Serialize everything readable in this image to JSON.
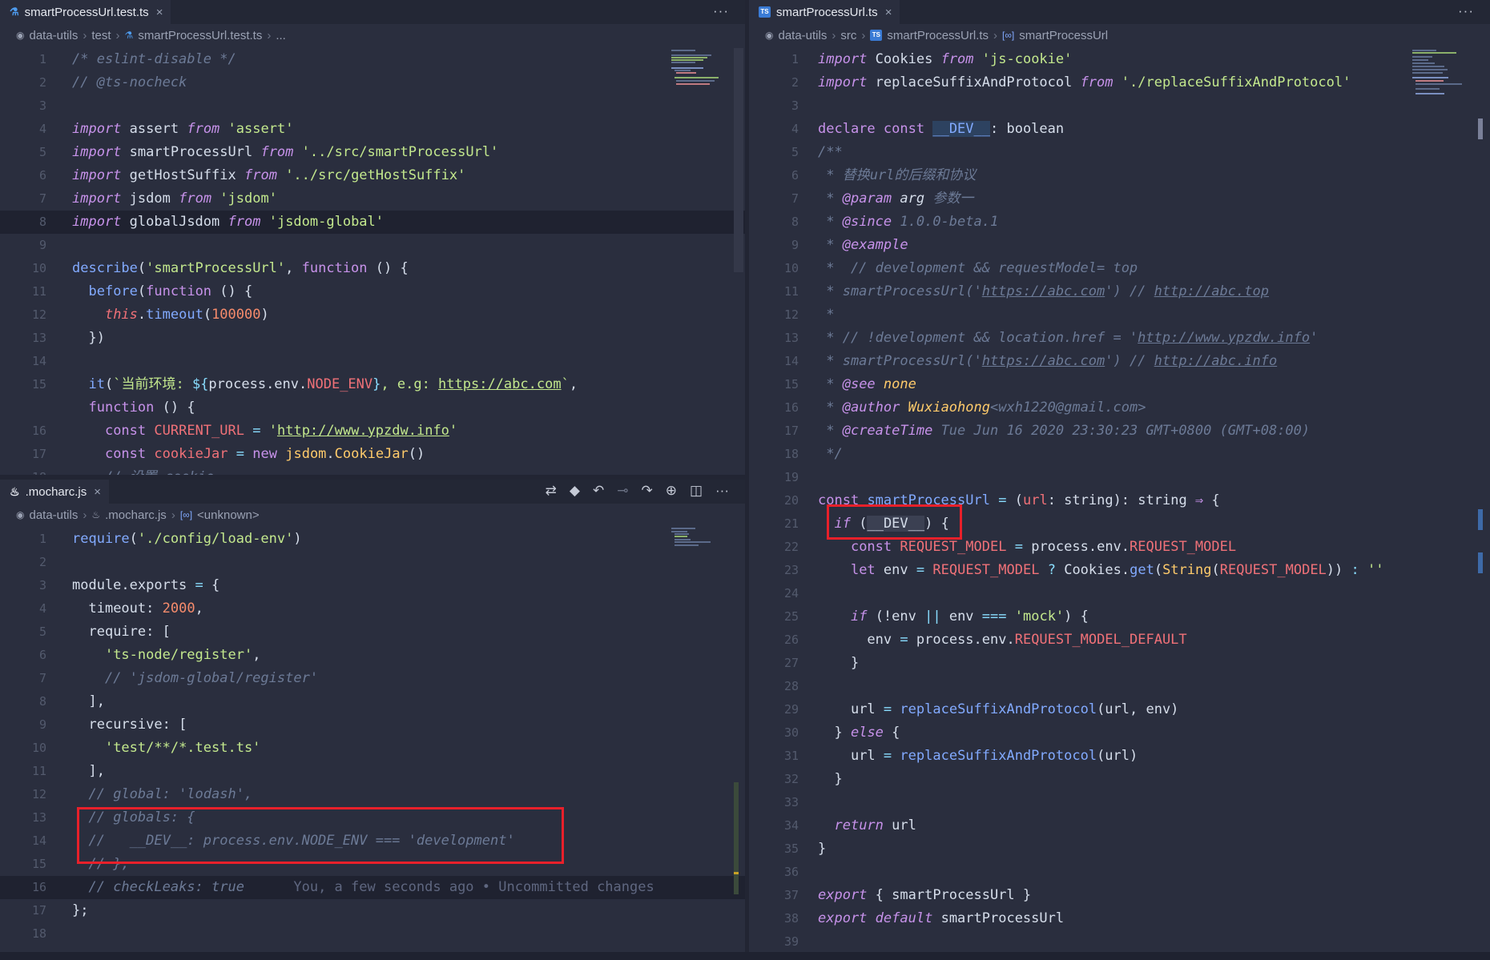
{
  "top_left": {
    "tab": {
      "label": "smartProcessUrl.test.ts",
      "close": "×"
    },
    "more": "···",
    "breadcrumb": [
      "data-utils",
      "test",
      "smartProcessUrl.test.ts",
      "..."
    ],
    "lines": [
      {
        "n": "1",
        "html": "<span class='cm'>/* eslint-disable */</span>"
      },
      {
        "n": "2",
        "html": "<span class='cm'>// @ts-nocheck</span>"
      },
      {
        "n": "3",
        "html": ""
      },
      {
        "n": "4",
        "html": "<span class='kw'>import</span> <span class='plain'>assert</span> <span class='kw'>from</span> <span class='str'>'assert'</span>"
      },
      {
        "n": "5",
        "html": "<span class='kw'>import</span> <span class='plain'>smartProcessUrl</span> <span class='kw'>from</span> <span class='str'>'../src/smartProcessUrl'</span>"
      },
      {
        "n": "6",
        "html": "<span class='kw'>import</span> <span class='plain'>getHostSuffix</span> <span class='kw'>from</span> <span class='str'>'../src/getHostSuffix'</span>"
      },
      {
        "n": "7",
        "html": "<span class='kw'>import</span> <span class='plain'>jsdom</span> <span class='kw'>from</span> <span class='str'>'jsdom'</span>"
      },
      {
        "n": "8",
        "html": "<span class='kw'>import</span> <span class='plain'>globalJsdom</span> <span class='kw'>from</span> <span class='str'>'jsdom-global'</span>",
        "hl": true
      },
      {
        "n": "9",
        "html": ""
      },
      {
        "n": "10",
        "html": "<span class='fn'>describe</span><span class='plain'>(</span><span class='str'>'smartProcessUrl'</span><span class='plain'>, </span><span class='kw2'>function</span><span class='plain'> () {</span>"
      },
      {
        "n": "11",
        "html": "  <span class='fn'>before</span><span class='plain'>(</span><span class='kw2'>function</span><span class='plain'> () {</span>"
      },
      {
        "n": "12",
        "html": "    <span class='var' style='font-style:italic'>this</span><span class='plain'>.</span><span class='fn'>timeout</span><span class='plain'>(</span><span class='num'>100000</span><span class='plain'>)</span>"
      },
      {
        "n": "13",
        "html": "  <span class='plain'>})</span>"
      },
      {
        "n": "14",
        "html": ""
      },
      {
        "n": "15",
        "html": "  <span class='fn'>it</span><span class='plain'>(</span><span class='str'>`当前环境: </span><span class='op'>${</span><span class='plain'>process.env.</span><span class='var'>NODE_ENV</span><span class='op'>}</span><span class='str'>, e.g: <u>https://abc.com</u>`</span><span class='plain'>,</span>"
      },
      {
        "n": "",
        "html": "  <span class='kw2'>function</span><span class='plain'> () {</span>"
      },
      {
        "n": "16",
        "html": "    <span class='kw2'>const</span> <span class='var'>CURRENT_URL</span> <span class='op'>=</span> <span class='str'>'<u>http://www.ypzdw.info</u>'</span>"
      },
      {
        "n": "17",
        "html": "    <span class='kw2'>const</span> <span class='var'>cookieJar</span> <span class='op'>=</span> <span class='kw2'>new</span> <span class='tp'>jsdom</span><span class='plain'>.</span><span class='tp'>CookieJar</span><span class='plain'>()</span>"
      },
      {
        "n": "18",
        "html": "    <span class='cm'>// 设置 cookie</span>"
      }
    ]
  },
  "bottom_left": {
    "tab": {
      "label": ".mocharc.js",
      "close": "×"
    },
    "toolbar_icons": [
      "compare-icon",
      "git-icon",
      "prev-change-icon",
      "dot-icon",
      "next-change-icon",
      "history-icon",
      "split-icon",
      "more-icon"
    ],
    "toolbar_glyphs": [
      "⇄",
      "◆",
      "↶",
      "⊸",
      "↷",
      "⊕",
      "◫",
      "···"
    ],
    "breadcrumb": [
      "data-utils",
      ".mocharc.js",
      "<unknown>"
    ],
    "lines": [
      {
        "n": "1",
        "html": "<span class='fn'>require</span><span class='plain'>(</span><span class='str'>'./config/load-env'</span><span class='plain'>)</span>"
      },
      {
        "n": "2",
        "html": ""
      },
      {
        "n": "3",
        "html": "<span class='plain'>module.exports</span> <span class='op'>=</span> <span class='plain'>{</span>"
      },
      {
        "n": "4",
        "html": "  <span class='plain'>timeout: </span><span class='num'>2000</span><span class='plain'>,</span>"
      },
      {
        "n": "5",
        "html": "  <span class='plain'>require: [</span>"
      },
      {
        "n": "6",
        "html": "    <span class='str'>'ts-node/register'</span><span class='plain'>,</span>"
      },
      {
        "n": "7",
        "html": "    <span class='cm'>// 'jsdom-global/register'</span>"
      },
      {
        "n": "8",
        "html": "  <span class='plain'>],</span>"
      },
      {
        "n": "9",
        "html": "  <span class='plain'>recursive: [</span>"
      },
      {
        "n": "10",
        "html": "    <span class='str'>'test/**/*.test.ts'</span>"
      },
      {
        "n": "11",
        "html": "  <span class='plain'>],</span>"
      },
      {
        "n": "12",
        "html": "  <span class='cm'>// global: 'lodash',</span>"
      },
      {
        "n": "13",
        "html": "  <span class='cm'>// globals: {</span>"
      },
      {
        "n": "14",
        "html": "  <span class='cm'>//   __DEV__: process.env.NODE_ENV === 'development'</span>"
      },
      {
        "n": "15",
        "html": "  <span class='cm'>// },</span>"
      },
      {
        "n": "16",
        "html": "  <span class='cm'>// checkLeaks: true</span>      <span class='blame'>You, a few seconds ago • Uncommitted changes</span>",
        "hl": true
      },
      {
        "n": "17",
        "html": "<span class='plain'>};</span>"
      },
      {
        "n": "18",
        "html": ""
      }
    ]
  },
  "right": {
    "tab": {
      "label": "smartProcessUrl.ts",
      "close": "×"
    },
    "more": "···",
    "breadcrumb": [
      "data-utils",
      "src",
      "smartProcessUrl.ts",
      "smartProcessUrl"
    ],
    "lines": [
      {
        "n": "1",
        "html": "<span class='kw'>import</span> <span class='plain'>Cookies</span> <span class='kw'>from</span> <span class='str'>'js-cookie'</span>"
      },
      {
        "n": "2",
        "html": "<span class='kw'>import</span> <span class='plain'>replaceSuffixAndProtocol</span> <span class='kw'>from</span> <span class='str'>'./replaceSuffixAndProtocol'</span>"
      },
      {
        "n": "3",
        "html": ""
      },
      {
        "n": "4",
        "html": "<span class='kw2'>declare</span> <span class='kw2'>const</span> <span class='fn' style='background:#2d4260'>__DEV__</span><span class='plain'>: boolean</span>"
      },
      {
        "n": "5",
        "html": "<span class='cm'>/**</span>"
      },
      {
        "n": "6",
        "html": "<span class='cm'> * 替换url的后缀和协议</span>"
      },
      {
        "n": "7",
        "html": "<span class='cm'> * </span><span class='kw'>@param</span> <span class='plain' style='font-style:italic'>arg</span> <span class='cm'>参数一</span>"
      },
      {
        "n": "8",
        "html": "<span class='cm'> * </span><span class='kw'>@since</span> <span class='cm'>1.0.0-beta.1</span>"
      },
      {
        "n": "9",
        "html": "<span class='cm'> * </span><span class='kw'>@example</span>"
      },
      {
        "n": "10",
        "html": "<span class='cm'> *  // development &amp;&amp; requestModel= top</span>"
      },
      {
        "n": "11",
        "html": "<span class='cm'> * smartProcessUrl('<u>https://abc.com</u>') // <u>http://abc.top</u></span>"
      },
      {
        "n": "12",
        "html": "<span class='cm'> *</span>"
      },
      {
        "n": "13",
        "html": "<span class='cm'> * // !development &amp;&amp; location.href = '<u>http://www.ypzdw.info</u>'</span>"
      },
      {
        "n": "14",
        "html": "<span class='cm'> * smartProcessUrl('<u>https://abc.com</u>') // <u>http://abc.info</u></span>"
      },
      {
        "n": "15",
        "html": "<span class='cm'> * </span><span class='kw'>@see</span> <span class='tp' style='font-style:italic'>none</span>"
      },
      {
        "n": "16",
        "html": "<span class='cm'> * </span><span class='kw'>@author</span> <span class='tp' style='font-style:italic'>Wuxiaohong</span><span class='cm'>&lt;wxh1220@gmail.com&gt;</span>"
      },
      {
        "n": "17",
        "html": "<span class='cm'> * </span><span class='kw'>@createTime</span> <span class='cm'>Tue Jun 16 2020 23:30:23 GMT+0800 (GMT+08:00)</span>"
      },
      {
        "n": "18",
        "html": "<span class='cm'> */</span>"
      },
      {
        "n": "19",
        "html": ""
      },
      {
        "n": "20",
        "html": "<span class='kw2'>const</span> <span class='fn'>smartProcessUrl</span> <span class='op'>=</span> <span class='plain'>(</span><span class='var'>url</span><span class='plain'>: string): string </span><span class='kw2'>⇒</span><span class='plain'> {</span>"
      },
      {
        "n": "21",
        "html": "  <span class='kw'>if</span> <span class='plain'>(</span><span class='plain' style='background:#3b4052'>__DEV__</span><span class='plain'>) {</span>"
      },
      {
        "n": "22",
        "html": "    <span class='kw2'>const</span> <span class='var'>REQUEST_MODEL</span> <span class='op'>=</span> <span class='plain'>process.env.</span><span class='var'>REQUEST_MODEL</span>"
      },
      {
        "n": "23",
        "html": "    <span class='kw2'>let</span> <span class='plain'>env</span> <span class='op'>=</span> <span class='var'>REQUEST_MODEL</span> <span class='op'>?</span> <span class='plain'>Cookies.</span><span class='fn'>get</span><span class='plain'>(</span><span class='tp'>String</span><span class='plain'>(</span><span class='var'>REQUEST_MODEL</span><span class='plain'>)) </span><span class='op'>:</span> <span class='str'>''</span>"
      },
      {
        "n": "24",
        "html": ""
      },
      {
        "n": "25",
        "html": "    <span class='kw'>if</span> <span class='plain'>(!env </span><span class='op'>||</span><span class='plain'> env </span><span class='op'>===</span> <span class='str'>'mock'</span><span class='plain'>) {</span>"
      },
      {
        "n": "26",
        "html": "      <span class='plain'>env</span> <span class='op'>=</span> <span class='plain'>process.env.</span><span class='var'>REQUEST_MODEL_DEFAULT</span>"
      },
      {
        "n": "27",
        "html": "    <span class='plain'>}</span>"
      },
      {
        "n": "28",
        "html": ""
      },
      {
        "n": "29",
        "html": "    <span class='plain'>url</span> <span class='op'>=</span> <span class='fn'>replaceSuffixAndProtocol</span><span class='plain'>(url, env)</span>"
      },
      {
        "n": "30",
        "html": "  <span class='plain'>} </span><span class='kw'>else</span><span class='plain'> {</span>"
      },
      {
        "n": "31",
        "html": "    <span class='plain'>url</span> <span class='op'>=</span> <span class='fn'>replaceSuffixAndProtocol</span><span class='plain'>(url)</span>"
      },
      {
        "n": "32",
        "html": "  <span class='plain'>}</span>"
      },
      {
        "n": "33",
        "html": ""
      },
      {
        "n": "34",
        "html": "  <span class='kw'>return</span> <span class='plain'>url</span>"
      },
      {
        "n": "35",
        "html": "<span class='plain'>}</span>"
      },
      {
        "n": "36",
        "html": ""
      },
      {
        "n": "37",
        "html": "<span class='kw'>export</span> <span class='plain'>{ smartProcessUrl }</span>"
      },
      {
        "n": "38",
        "html": "<span class='kw'>export</span> <span class='kw'>default</span> <span class='plain'>smartProcessUrl</span>"
      },
      {
        "n": "39",
        "html": ""
      }
    ]
  },
  "icons": {
    "breadcrumb_root": "source-control-icon",
    "function": "symbol-icon",
    "flask": "test-flask-icon",
    "ts": "typescript-icon",
    "js": "javascript-icon"
  },
  "colors": {
    "highlight_box": "#e8202a",
    "background": "#2a2e3e"
  }
}
